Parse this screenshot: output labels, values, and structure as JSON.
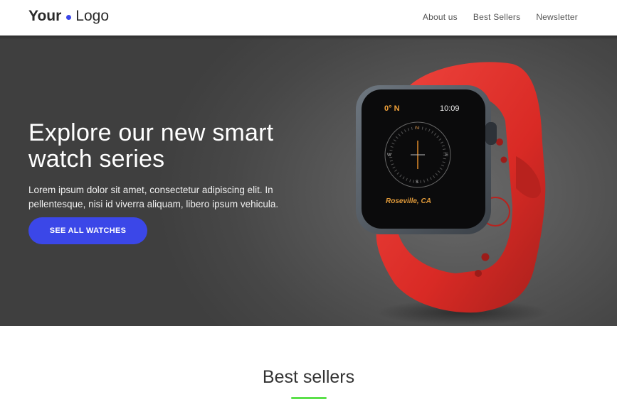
{
  "brand": {
    "logo_bold": "Your",
    "logo_light": "Logo",
    "accent_color": "#3b47e8"
  },
  "nav": {
    "items": [
      {
        "label": "About us"
      },
      {
        "label": "Best Sellers"
      },
      {
        "label": "Newsletter"
      }
    ]
  },
  "hero": {
    "title": "Explore our new smart watch series",
    "text": "Lorem ipsum dolor sit amet, consectetur adipiscing elit. In pellentesque, nisi id viverra aliquam, libero ipsum vehicula.",
    "cta_label": "SEE ALL WATCHES",
    "watch": {
      "heading": "0° N",
      "time": "10:09",
      "location": "Roseville, CA",
      "band_color": "#e0342f"
    }
  },
  "best_sellers": {
    "title": "Best sellers",
    "underline_color": "#5be04a"
  }
}
